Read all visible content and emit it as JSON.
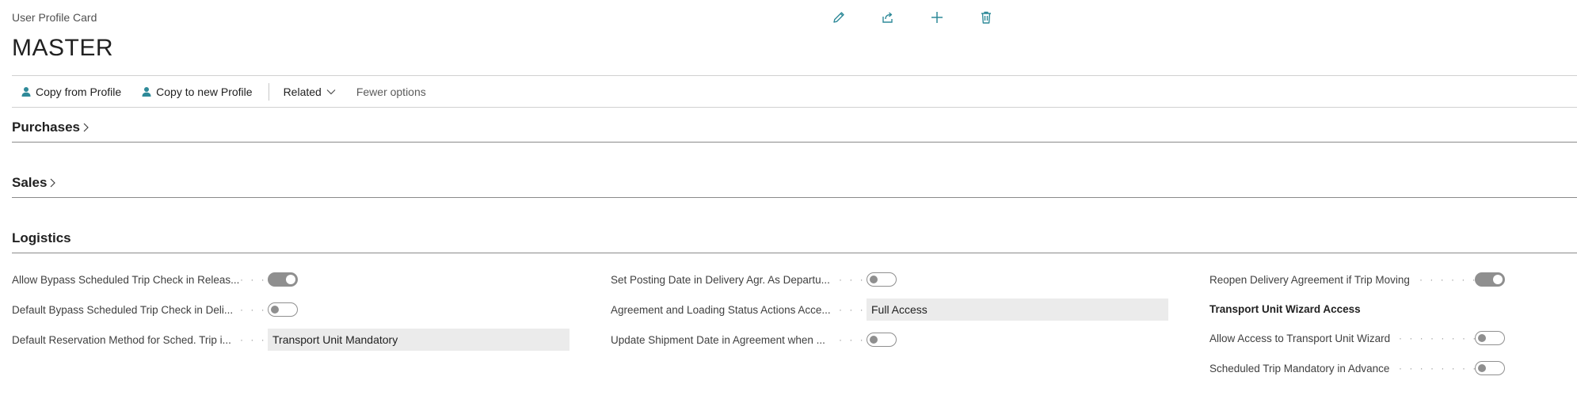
{
  "header": {
    "caption": "User Profile Card",
    "title": "MASTER"
  },
  "top_actions": {
    "icons": [
      "edit-icon",
      "share-icon",
      "add-icon",
      "delete-icon"
    ]
  },
  "actionbar": {
    "copy_from_profile": "Copy from Profile",
    "copy_to_new_profile": "Copy to new Profile",
    "related": "Related",
    "fewer_options": "Fewer options"
  },
  "sections": {
    "purchases": "Purchases",
    "sales": "Sales",
    "logistics": "Logistics"
  },
  "logistics": {
    "col1": [
      {
        "label": "Allow Bypass Scheduled Trip Check in Releas...",
        "type": "toggle",
        "value": true
      },
      {
        "label": "Default Bypass Scheduled Trip Check in Deli...",
        "type": "toggle",
        "value": false
      },
      {
        "label": "Default Reservation Method for Sched. Trip i...",
        "type": "field",
        "value": "Transport Unit Mandatory"
      }
    ],
    "col2": [
      {
        "label": "Set Posting Date in Delivery Agr. As Departu...",
        "type": "toggle",
        "value": false
      },
      {
        "label": "Agreement and Loading Status Actions Acce...",
        "type": "field",
        "value": "Full Access"
      },
      {
        "label": "Update Shipment Date in Agreement when ...",
        "type": "toggle",
        "value": false
      }
    ],
    "col3": [
      {
        "label": "Reopen Delivery Agreement if Trip Moving",
        "type": "toggle",
        "value": true
      },
      {
        "label": "Transport Unit Wizard Access",
        "type": "group"
      },
      {
        "label": "Allow Access to Transport Unit Wizard",
        "type": "toggle",
        "value": false
      },
      {
        "label": "Scheduled Trip Mandatory in Advance",
        "type": "toggle",
        "value": false
      }
    ]
  },
  "colors": {
    "accent": "#2f8a99",
    "toggle": "#8f8f8f",
    "field_bg": "#ebebeb"
  }
}
